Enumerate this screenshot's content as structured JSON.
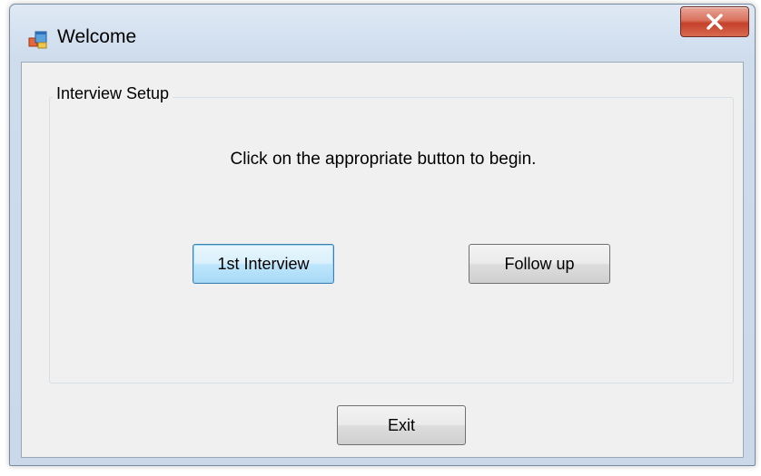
{
  "window": {
    "title": "Welcome",
    "icon": "application-form-icon",
    "close_icon": "close-x-icon"
  },
  "group": {
    "legend": "Interview Setup",
    "instruction": "Click on the appropriate button to begin."
  },
  "buttons": {
    "first_interview": "1st Interview",
    "follow_up": "Follow up",
    "exit": "Exit"
  },
  "colors": {
    "close_button": "#c5402a",
    "focused_button_border": "#3c7fb1",
    "dialog_background": "#f0f0f0"
  }
}
